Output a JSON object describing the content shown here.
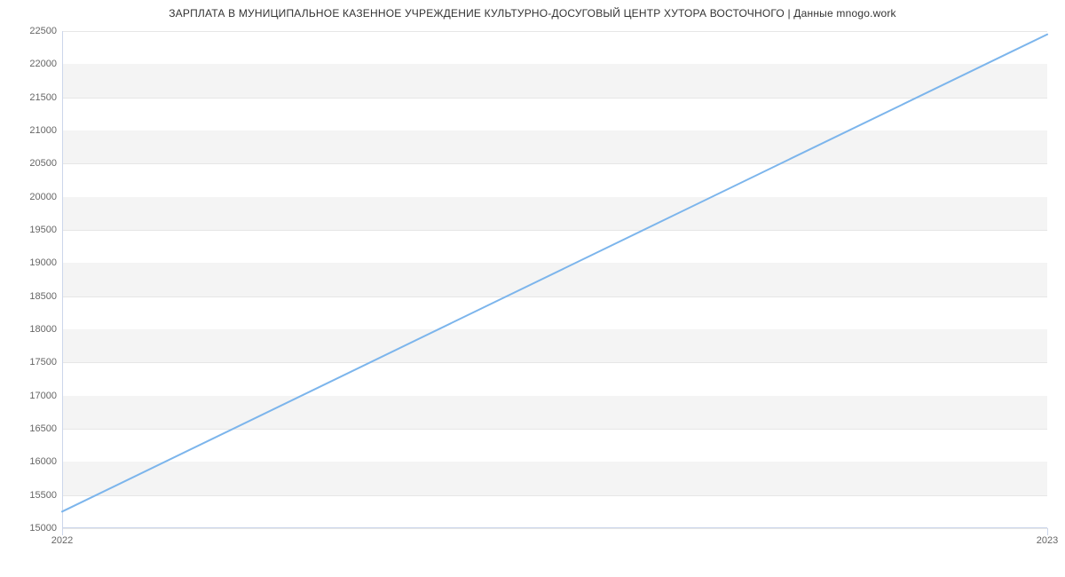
{
  "chart_data": {
    "type": "line",
    "title": "ЗАРПЛАТА В МУНИЦИПАЛЬНОЕ КАЗЕННОЕ УЧРЕЖДЕНИЕ КУЛЬТУРНО-ДОСУГОВЫЙ ЦЕНТР ХУТОРА ВОСТОЧНОГО | Данные mnogo.work",
    "xlabel": "",
    "ylabel": "",
    "categories": [
      "2022",
      "2023"
    ],
    "x": [
      2022,
      2023
    ],
    "values": [
      15250,
      22450
    ],
    "y_ticks": [
      15000,
      15500,
      16000,
      16500,
      17000,
      17500,
      18000,
      18500,
      19000,
      19500,
      20000,
      20500,
      21000,
      21500,
      22000,
      22500
    ],
    "ylim": [
      15000,
      22500
    ],
    "x_ticks": [
      "2022",
      "2023"
    ],
    "grid": true,
    "series_color": "#7cb5ec"
  }
}
